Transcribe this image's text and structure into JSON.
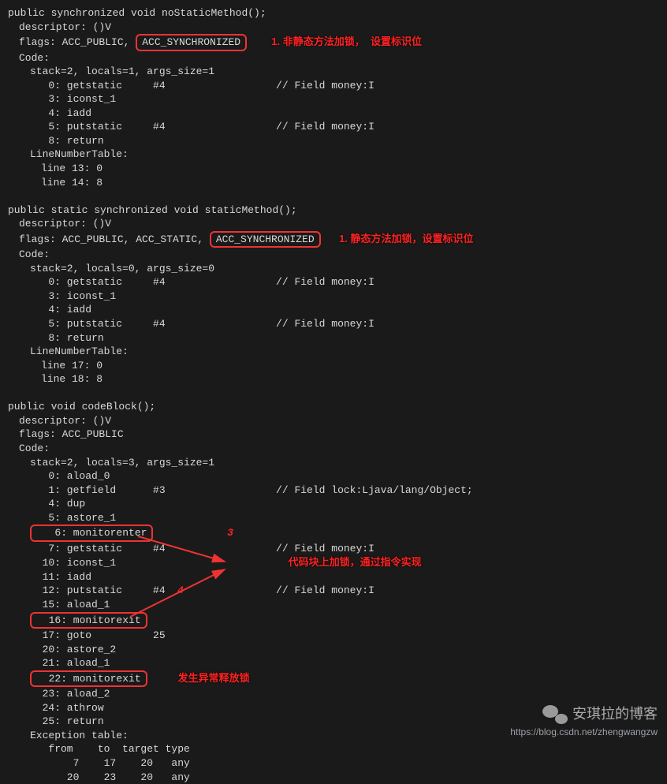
{
  "m1": {
    "sig": "public synchronized void noStaticMethod();",
    "desc": "descriptor: ()V",
    "flags_prefix": "flags: ACC_PUBLIC, ",
    "flags_box": "ACC_SYNCHRONIZED",
    "anno": "1. 非静态方法加锁，  设置标识位",
    "code_label": "Code:",
    "stack": "stack=2, locals=1, args_size=1",
    "l0": "   0: getstatic     #4                  // Field money:I",
    "l1": "   3: iconst_1",
    "l2": "   4: iadd",
    "l3": "   5: putstatic     #4                  // Field money:I",
    "l4": "   8: return",
    "lnt": "LineNumberTable:",
    "ln0": "line 13: 0",
    "ln1": "line 14: 8"
  },
  "m2": {
    "sig": "public static synchronized void staticMethod();",
    "desc": "descriptor: ()V",
    "flags_prefix": "flags: ACC_PUBLIC, ACC_STATIC, ",
    "flags_box": "ACC_SYNCHRONIZED",
    "anno": "1. 静态方法加锁，设置标识位",
    "code_label": "Code:",
    "stack": "stack=2, locals=0, args_size=0",
    "l0": "   0: getstatic     #4                  // Field money:I",
    "l1": "   3: iconst_1",
    "l2": "   4: iadd",
    "l3": "   5: putstatic     #4                  // Field money:I",
    "l4": "   8: return",
    "lnt": "LineNumberTable:",
    "ln0": "line 17: 0",
    "ln1": "line 18: 8"
  },
  "m3": {
    "sig": "public void codeBlock();",
    "desc": "descriptor: ()V",
    "flags": "flags: ACC_PUBLIC",
    "code_label": "Code:",
    "stack": "stack=2, locals=3, args_size=1",
    "l0": "   0: aload_0",
    "l1": "   1: getfield      #3                  // Field lock:Ljava/lang/Object;",
    "l2": "   4: dup",
    "l3": "   5: astore_1",
    "l4_box": "   6: monitorenter",
    "l4_num": "3",
    "l5": "   7: getstatic     #4                  // Field money:I",
    "l6": "  10: iconst_1",
    "anno_block": "代码块上加锁，通过指令实现",
    "l7": "  11: iadd",
    "l8": "  12: putstatic     #4                  // Field money:I",
    "l8_num": "4",
    "l9": "  15: aload_1",
    "l10_box": "  16: monitorexit",
    "l11": "  17: goto          25",
    "l12": "  20: astore_2",
    "l13": "  21: aload_1",
    "l14_box": "  22: monitorexit",
    "l14_anno": "发生异常释放锁",
    "l15": "  23: aload_2",
    "l16": "  24: athrow",
    "l17": "  25: return",
    "exc": "Exception table:",
    "exh": "   from    to  target type",
    "ex0": "       7    17    20   any",
    "ex1": "      20    23    20   any"
  },
  "corner": {
    "name": "安琪拉的博客",
    "url": "https://blog.csdn.net/zhengwangzw"
  }
}
